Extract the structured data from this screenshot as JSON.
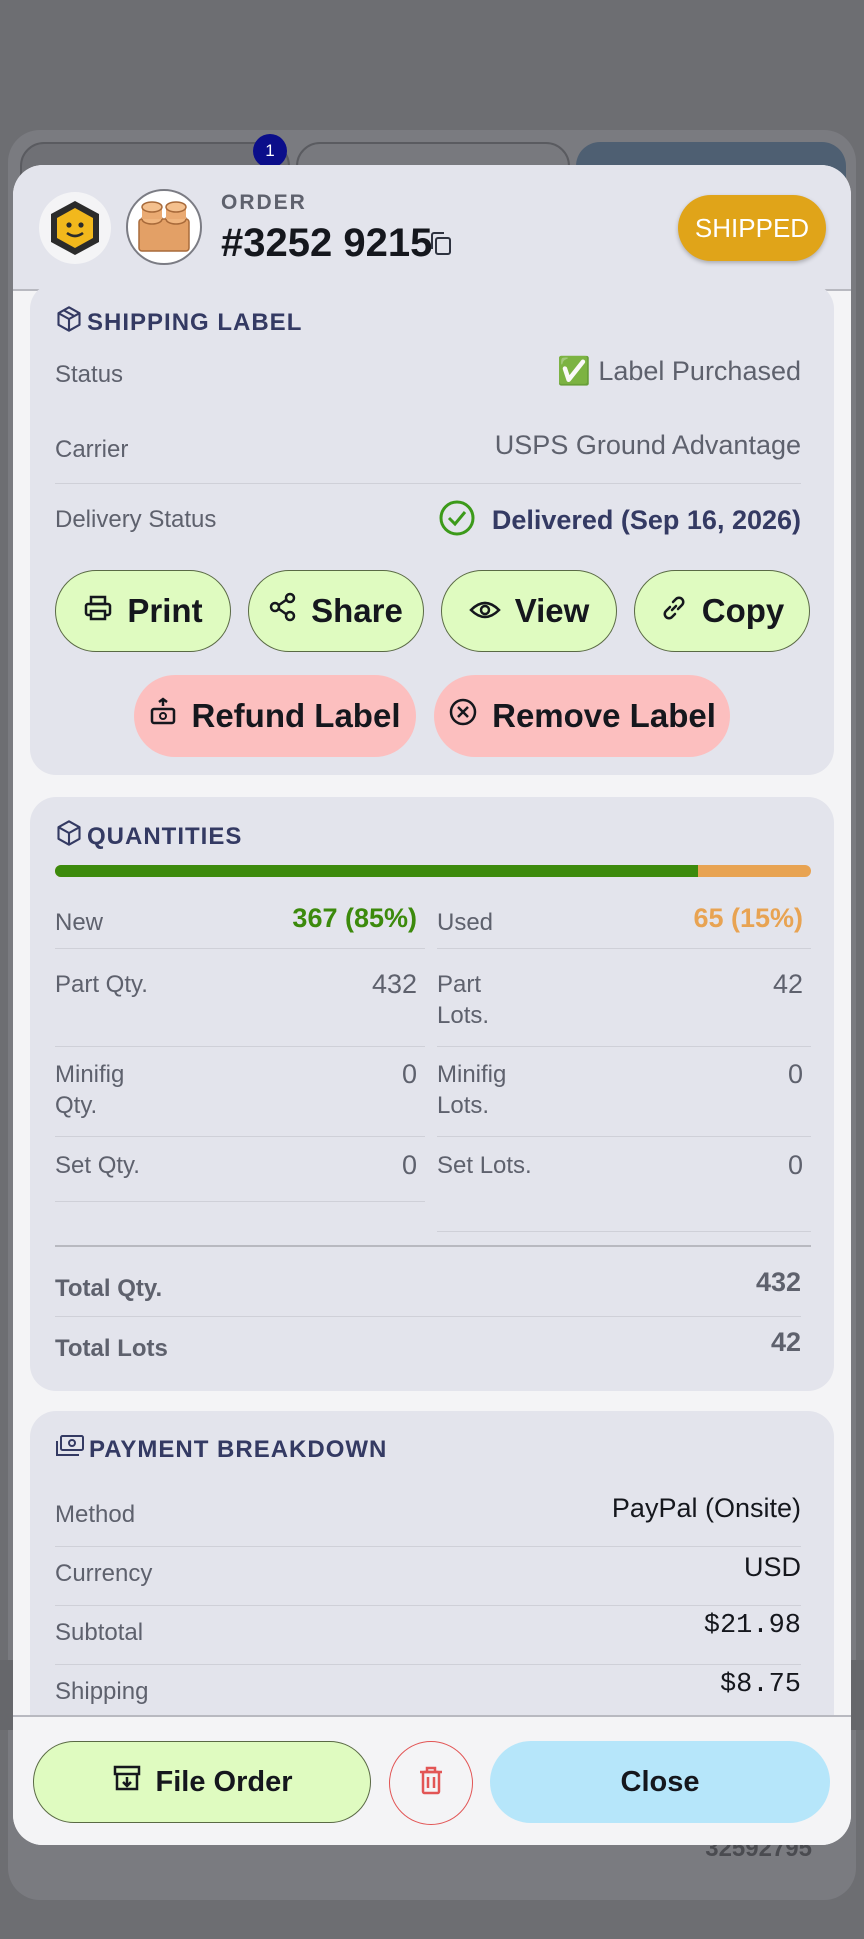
{
  "background": {
    "tab_badge": "1",
    "footer_hint": "32592795"
  },
  "header": {
    "kicker": "ORDER",
    "order_number": "#3252 9215",
    "status": "SHIPPED",
    "status_color": "#e0a419"
  },
  "shipping_label": {
    "title": "SHIPPING LABEL",
    "rows": [
      {
        "label": "Status",
        "value": "✅ Label Purchased"
      },
      {
        "label": "Carrier",
        "value": "USPS Ground Advantage"
      },
      {
        "label": "Delivery Status",
        "value": "Delivered (Sep 16, 2026)"
      }
    ],
    "actions": {
      "print": "Print",
      "share": "Share",
      "view": "View",
      "copy": "Copy",
      "refund": "Refund Label",
      "remove": "Remove Label"
    }
  },
  "quantities": {
    "title": "QUANTITIES",
    "new_fraction": 0.85,
    "new_color": "#3c8a0c",
    "used_color": "#e8a352",
    "left": [
      {
        "label": "New",
        "value": "367 (85%)"
      },
      {
        "label": "Part Qty.",
        "value": "432"
      },
      {
        "label": "Minifig Qty.",
        "value": "0"
      },
      {
        "label": "Set Qty.",
        "value": "0"
      }
    ],
    "right": [
      {
        "label": "Used",
        "value": "65 (15%)"
      },
      {
        "label": "Part Lots.",
        "value": "42"
      },
      {
        "label": "Minifig Lots.",
        "value": "0"
      },
      {
        "label": "Set Lots.",
        "value": "0"
      }
    ],
    "totals": [
      {
        "label": "Total Qty.",
        "value": "432"
      },
      {
        "label": "Total Lots",
        "value": "42"
      }
    ]
  },
  "payment": {
    "title": "PAYMENT BREAKDOWN",
    "rows": [
      {
        "label": "Method",
        "value": "PayPal (Onsite)"
      },
      {
        "label": "Currency",
        "value": "USD"
      },
      {
        "label": "Subtotal",
        "value": "$21.98"
      },
      {
        "label": "Shipping",
        "value": "$8.75"
      }
    ]
  },
  "footer": {
    "file_order": "File Order",
    "close": "Close"
  }
}
